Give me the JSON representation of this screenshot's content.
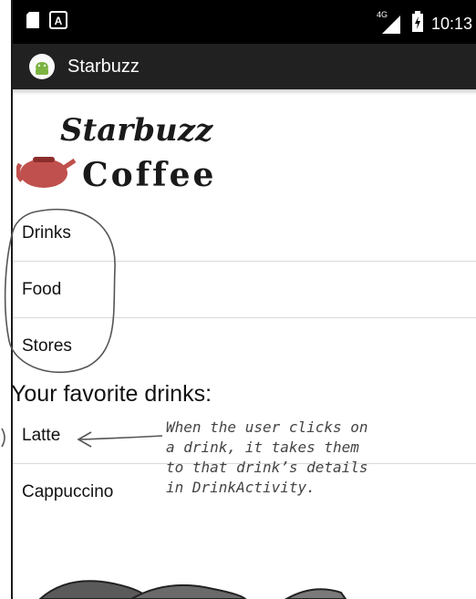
{
  "status_bar": {
    "network": "4G",
    "time": "10:13"
  },
  "app_bar": {
    "title": "Starbuzz"
  },
  "logo": {
    "line1": "Starbuzz",
    "line2": "Coffee"
  },
  "options": [
    {
      "label": "Drinks"
    },
    {
      "label": "Food"
    },
    {
      "label": "Stores"
    }
  ],
  "favorites": {
    "header": "Your favorite drinks:",
    "items": [
      {
        "label": "Latte"
      },
      {
        "label": "Cappuccino"
      }
    ]
  },
  "annotation": {
    "lines": [
      "When the user clicks on",
      "a drink, it takes them",
      "to that drink’s details",
      "in DrinkActivity."
    ]
  },
  "colors": {
    "status_bar": "#000000",
    "app_bar": "#212121",
    "logo_red": "#c0504d",
    "ink": "#555555"
  },
  "icons": [
    "sim-card-icon",
    "notification-a-icon",
    "signal-4g-icon",
    "battery-charging-icon",
    "android-app-icon"
  ]
}
